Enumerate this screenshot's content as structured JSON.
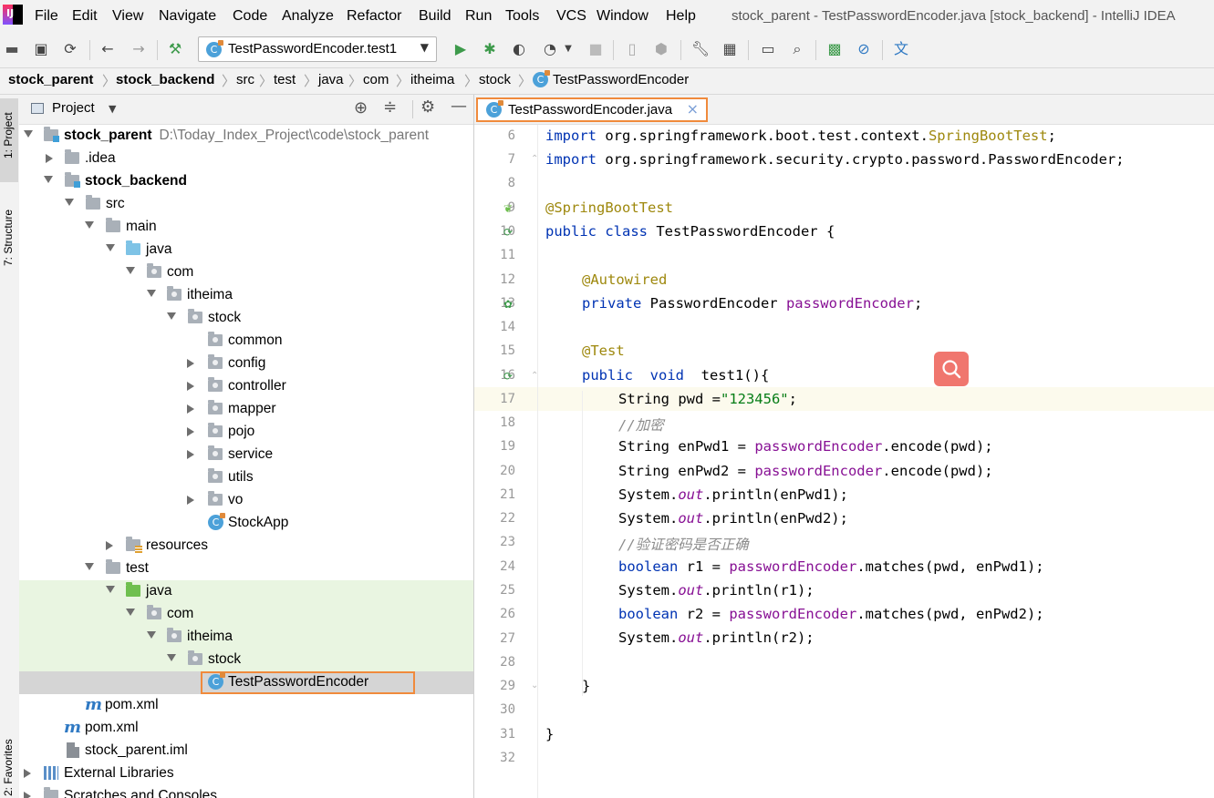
{
  "menu": {
    "items": [
      "File",
      "Edit",
      "View",
      "Navigate",
      "Code",
      "Analyze",
      "Refactor",
      "Build",
      "Run",
      "Tools",
      "VCS",
      "Window",
      "Help"
    ],
    "window_title": "stock_parent - TestPasswordEncoder.java [stock_backend] - IntelliJ IDEA"
  },
  "toolbar": {
    "run_config": "TestPasswordEncoder.test1",
    "icons": [
      "open-folder-icon",
      "save-icon",
      "sync-icon",
      "back-icon",
      "forward-icon",
      "build-hammer-icon",
      "run-icon",
      "debug-icon",
      "coverage-icon",
      "profile-icon",
      "stop-icon",
      "attach-icon",
      "deploy-icon",
      "settings-wrench-icon",
      "project-structure-icon",
      "terminal-icon",
      "search-icon",
      "monitor-icon",
      "no-entry-icon",
      "translate-icon"
    ]
  },
  "breadcrumbs": [
    "stock_parent",
    "stock_backend",
    "src",
    "test",
    "java",
    "com",
    "itheima",
    "stock",
    "TestPasswordEncoder"
  ],
  "side_tabs": {
    "project": "1: Project",
    "structure": "7: Structure",
    "favorites": "2: Favorites"
  },
  "project_panel": {
    "title": "Project",
    "tree": [
      {
        "label": "stock_parent",
        "path": "D:\\Today_Index_Project\\code\\stock_parent",
        "bold": true
      },
      {
        "label": ".idea"
      },
      {
        "label": "stock_backend",
        "bold": true
      },
      {
        "label": "src"
      },
      {
        "label": "main"
      },
      {
        "label": "java"
      },
      {
        "label": "com"
      },
      {
        "label": "itheima"
      },
      {
        "label": "stock"
      },
      {
        "label": "common"
      },
      {
        "label": "config"
      },
      {
        "label": "controller"
      },
      {
        "label": "mapper"
      },
      {
        "label": "pojo"
      },
      {
        "label": "service"
      },
      {
        "label": "utils"
      },
      {
        "label": "vo"
      },
      {
        "label": "StockApp"
      },
      {
        "label": "resources"
      },
      {
        "label": "test"
      },
      {
        "label": "java"
      },
      {
        "label": "com"
      },
      {
        "label": "itheima"
      },
      {
        "label": "stock"
      },
      {
        "label": "TestPasswordEncoder"
      },
      {
        "label": "pom.xml"
      },
      {
        "label": "pom.xml"
      },
      {
        "label": "stock_parent.iml"
      },
      {
        "label": "External Libraries"
      },
      {
        "label": "Scratches and Consoles"
      }
    ]
  },
  "editor": {
    "tab": "TestPasswordEncoder.java",
    "line_numbers": [
      "6",
      "7",
      "8",
      "9",
      "10",
      "11",
      "12",
      "13",
      "14",
      "15",
      "16",
      "17",
      "18",
      "19",
      "20",
      "21",
      "22",
      "23",
      "24",
      "25",
      "26",
      "27",
      "28",
      "29",
      "30",
      "31",
      "32"
    ],
    "code": {
      "l6_kw": "import",
      "l6_pkg": " org.springframework.boot.test.context.",
      "l6_cls": "SpringBootTest",
      "l6_end": ";",
      "l7_kw": "import",
      "l7_rest": " org.springframework.security.crypto.password.PasswordEncoder;",
      "l9": "@SpringBootTest",
      "l10_kw": "public class",
      "l10_rest": " TestPasswordEncoder {",
      "l12": "@Autowired",
      "l13_kw": "private",
      "l13_type": " PasswordEncoder ",
      "l13_fld": "passwordEncoder",
      "l13_end": ";",
      "l15": "@Test",
      "l16_kw": "public  void",
      "l16_rest": "  test1(){",
      "l17_a": "String pwd =",
      "l17_str": "\"123456\"",
      "l17_end": ";",
      "l18": "//加密",
      "l19_a": "String enPwd1 = ",
      "l19_fld": "passwordEncoder",
      "l19_end": ".encode(pwd);",
      "l20_a": "String enPwd2 = ",
      "l20_fld": "passwordEncoder",
      "l20_end": ".encode(pwd);",
      "l21_a": "System.",
      "l21_out": "out",
      "l21_end": ".println(enPwd1);",
      "l22_a": "System.",
      "l22_out": "out",
      "l22_end": ".println(enPwd2);",
      "l23": "//验证密码是否正确",
      "l24_kw": "boolean",
      "l24_a": " r1 = ",
      "l24_fld": "passwordEncoder",
      "l24_end": ".matches(pwd, enPwd1);",
      "l25_a": "System.",
      "l25_out": "out",
      "l25_end": ".println(r1);",
      "l26_kw": "boolean",
      "l26_a": " r2 = ",
      "l26_fld": "passwordEncoder",
      "l26_end": ".matches(pwd, enPwd2);",
      "l27_a": "System.",
      "l27_out": "out",
      "l27_end": ".println(r2);",
      "l29": "}",
      "l31": "}"
    }
  },
  "colors": {
    "keyword": "#0033b3",
    "annotation": "#9e880d",
    "field": "#871094",
    "string": "#067d17",
    "comment": "#8c8c8c",
    "highlight_border": "#f08a3c",
    "search_button": "#f0766e"
  }
}
